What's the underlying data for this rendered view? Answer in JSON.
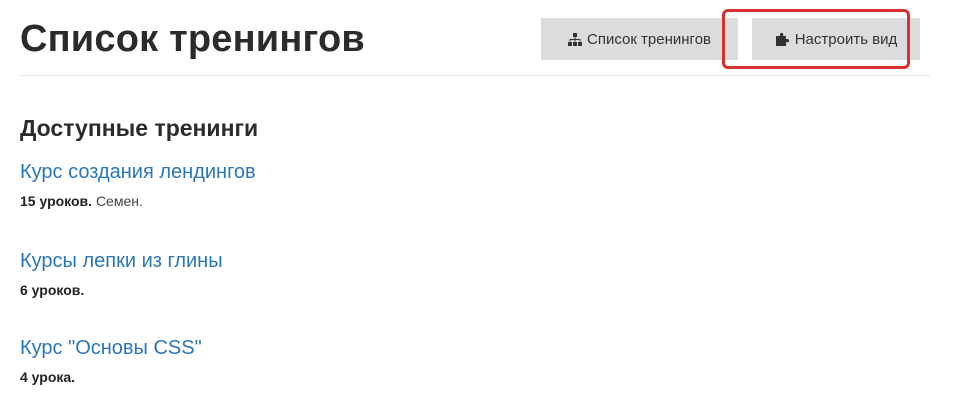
{
  "header": {
    "title": "Список тренингов",
    "buttons": {
      "list_label": "Список тренингов",
      "list_icon": "sitemap-icon",
      "customize_label": "Настроить вид",
      "customize_icon": "puzzle-icon"
    },
    "highlight_color": "#d9302f"
  },
  "section": {
    "title": "Доступные тренинги"
  },
  "trainings": [
    {
      "title": "Курс создания лендингов",
      "lessons": "15 уроков.",
      "author": "Семен."
    },
    {
      "title": "Курсы лепки из глины",
      "lessons": "6 уроков.",
      "author": ""
    },
    {
      "title": "Курс \"Основы CSS\"",
      "lessons": "4 урока.",
      "author": ""
    }
  ],
  "colors": {
    "link": "#2a77b8",
    "button_bg": "#dcdcdc",
    "title": "#2b2b2b"
  }
}
